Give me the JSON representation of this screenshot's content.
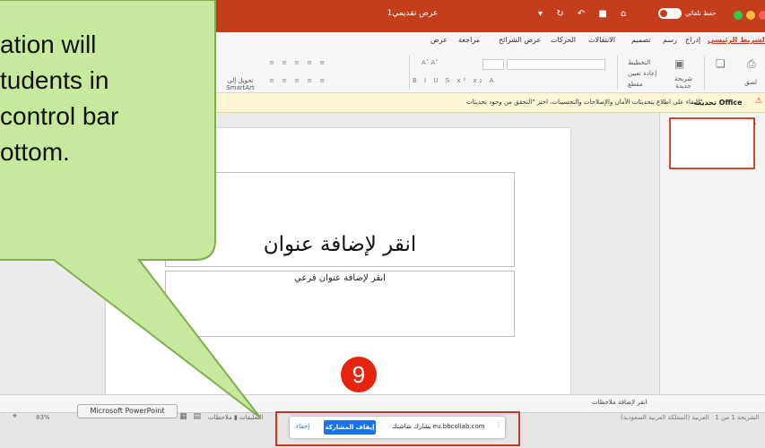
{
  "window": {
    "title": "عرض تقديمي1",
    "autosave_label": "حفظ تلقائي",
    "traffic_colors": [
      "#fc605b",
      "#fdbc40",
      "#34c84a"
    ],
    "accent": "#c43e1c"
  },
  "ribbon": {
    "tabs": [
      {
        "label": "الشريط الرئيسي",
        "active": true
      },
      {
        "label": "إدراج"
      },
      {
        "label": "رسم"
      },
      {
        "label": "تصميم"
      },
      {
        "label": "الانتقالات"
      },
      {
        "label": "الحركات"
      },
      {
        "label": "عرض الشرائح"
      },
      {
        "label": "مراجعة"
      },
      {
        "label": "عرض"
      }
    ],
    "buttons": {
      "paste": "لصق",
      "new_slide": "شريحة جديدة",
      "layout": "التخطيط",
      "reset": "إعادة تعيين",
      "section": "مقطع",
      "smartart": "تحويل إلى SmartArt"
    }
  },
  "update_bar": {
    "strong": "تحديث Office",
    "text": "للبقاء على اطلاع بتحديثات الأمان والإصلاحات والتحسينات، اختر \"التحقق من وجود تحديثات\"."
  },
  "slide": {
    "title_placeholder": "انقر لإضافة عنوان",
    "subtitle_placeholder": "انقر لإضافة عنوان فرعي"
  },
  "thumbnails": {
    "slide_number": "1"
  },
  "notes": {
    "placeholder": "انقر لإضافة ملاحظات"
  },
  "statusbar": {
    "slide_info": "الشريحة 1 من 1",
    "language": "العربية (المملكة العربية السعودية)",
    "zoom": "83%",
    "comments": "التعليقات",
    "notes_label": "ملاحظات"
  },
  "tooltip": {
    "text": "Microsoft PowerPoint"
  },
  "sharing_bar": {
    "text": "يشارك شاشتك eu.bbcollab.com",
    "stop_label": "إيقاف المشاركة",
    "hide_label": "إخفاء"
  },
  "step_badge": {
    "number": "9",
    "color": "#e7240d"
  },
  "callout": {
    "lines": [
      "ation will",
      "tudents in",
      "control bar",
      "ottom."
    ],
    "fill": "#c7e99e",
    "stroke": "#7fae4e"
  }
}
